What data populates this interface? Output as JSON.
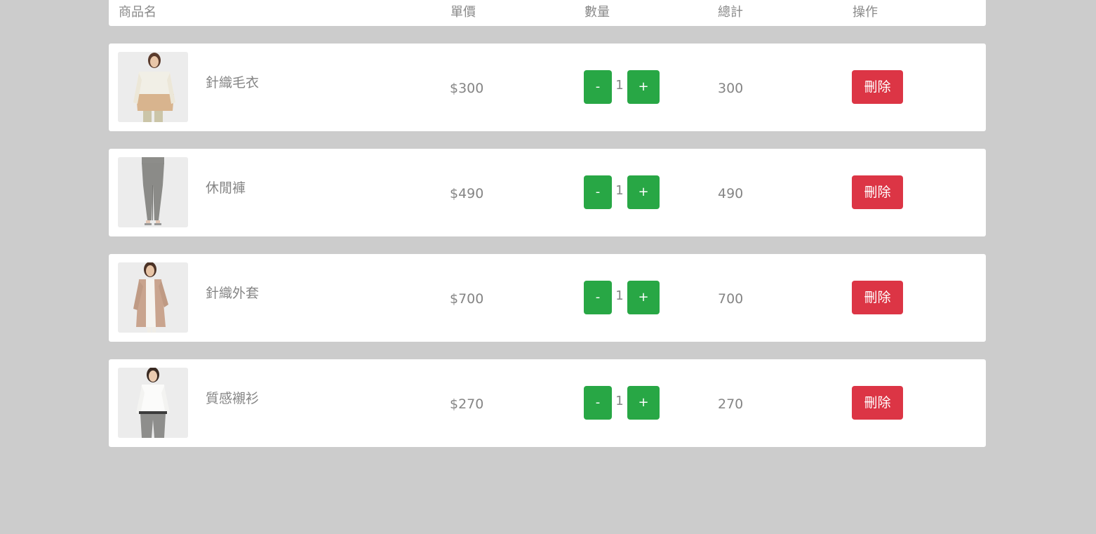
{
  "header": {
    "name": "商品名",
    "price": "單價",
    "quantity": "數量",
    "total": "總計",
    "action": "操作"
  },
  "items": [
    {
      "name": "針織毛衣",
      "price": "$300",
      "quantity": "1",
      "total": "300",
      "minus_label": "-",
      "plus_label": "+",
      "delete_label": "刪除",
      "image": "sweater-photo"
    },
    {
      "name": "休閒褲",
      "price": "$490",
      "quantity": "1",
      "total": "490",
      "minus_label": "-",
      "plus_label": "+",
      "delete_label": "刪除",
      "image": "pants-photo"
    },
    {
      "name": "針織外套",
      "price": "$700",
      "quantity": "1",
      "total": "700",
      "minus_label": "-",
      "plus_label": "+",
      "delete_label": "刪除",
      "image": "cardigan-photo"
    },
    {
      "name": "質感襯衫",
      "price": "$270",
      "quantity": "1",
      "total": "270",
      "minus_label": "-",
      "plus_label": "+",
      "delete_label": "刪除",
      "image": "shirt-photo"
    }
  ],
  "colors": {
    "background": "#cccccc",
    "quantity_button": "#28a745",
    "delete_button": "#dc3545"
  }
}
